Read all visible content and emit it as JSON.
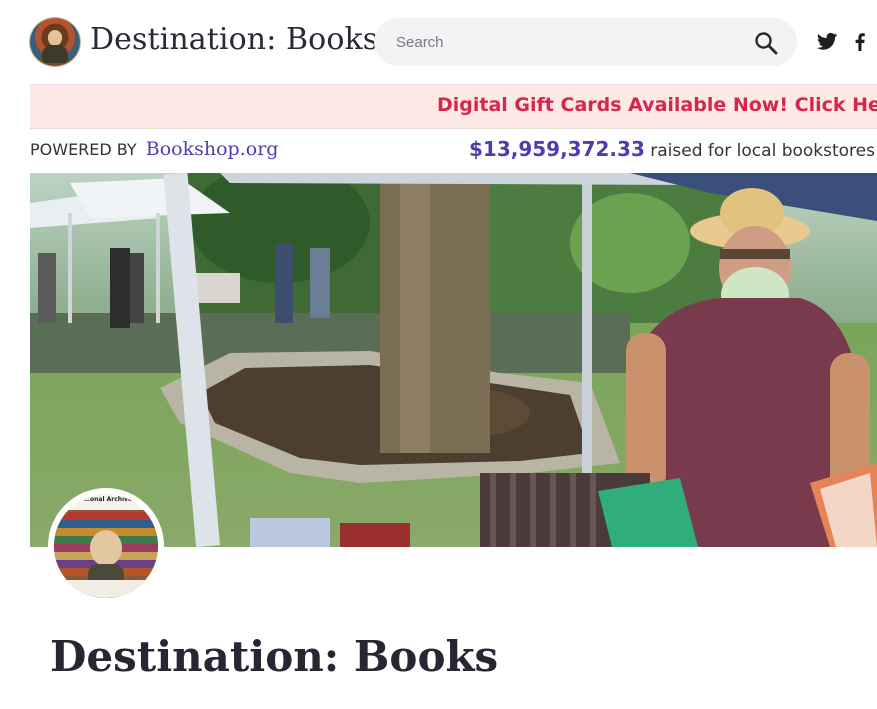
{
  "header": {
    "site_title": "Destination: Books",
    "logo_icon": "store-logo",
    "search_placeholder": "Search",
    "search_icon": "search-icon",
    "social": [
      "twitter-icon",
      "facebook-icon"
    ]
  },
  "promo": {
    "text": "Digital Gift Cards Available Now! Click Here"
  },
  "powered_by": {
    "label": "POWERED BY",
    "link": "Bookshop.org"
  },
  "raised": {
    "amount": "$13,959,372.33",
    "suffix": "raised for local bookstores"
  },
  "avatar": {
    "caption": "…onal Archive"
  },
  "store": {
    "title": "Destination: Books"
  },
  "colors": {
    "brand_purple": "#523bb0",
    "promo_red": "#d7264d",
    "promo_bg": "#fde9e6"
  }
}
